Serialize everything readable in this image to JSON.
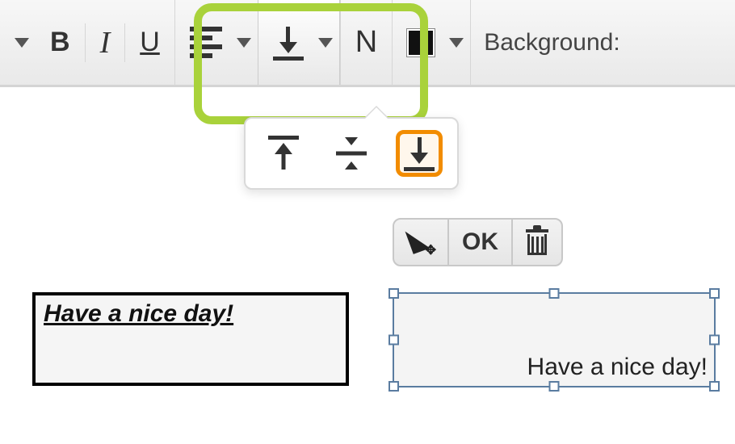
{
  "toolbar": {
    "bold": "B",
    "italic": "I",
    "underline": "U",
    "noformat": "N",
    "background_label": "Background:",
    "fill_color": "#111111"
  },
  "context_bar": {
    "ok": "OK"
  },
  "dropdown": {
    "options": [
      "top",
      "middle",
      "bottom"
    ],
    "selected": "bottom"
  },
  "boxes": {
    "left_text": "Have a nice day!",
    "right_text": "Have a nice day!"
  }
}
